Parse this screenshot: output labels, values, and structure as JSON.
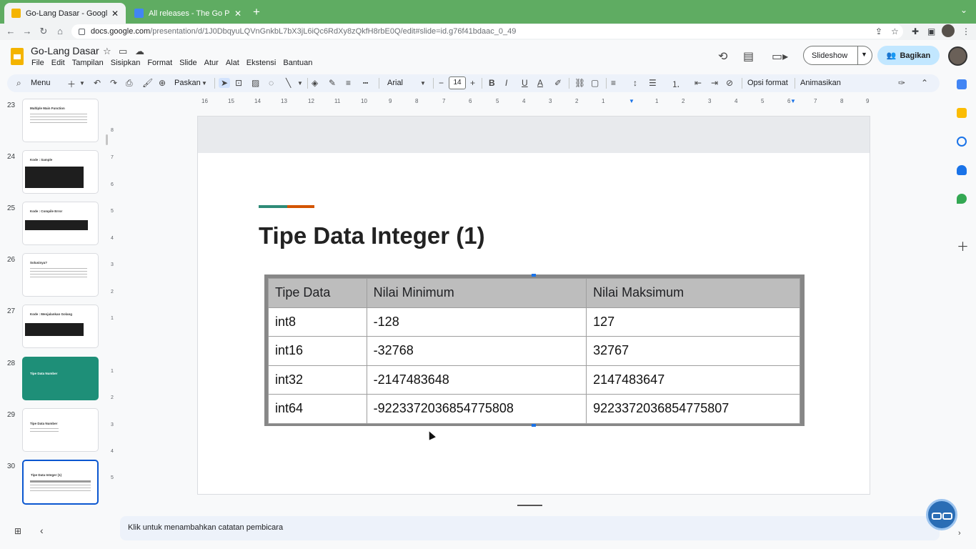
{
  "browser": {
    "tabs": [
      {
        "title": "Go-Lang Dasar - Google Slide",
        "active": true,
        "favicon_color": "#f4b400"
      },
      {
        "title": "All releases - The Go Programm",
        "active": false,
        "favicon_color": "#4285f4"
      }
    ],
    "new_tab_symbol": "+",
    "url_host": "docs.google.com",
    "url_path": "/presentation/d/1J0DbqyuLQVnGnkbL7bX3jL6iQc6RdXy8zQkfH8rbE0Q/edit#slide=id.g76f41bdaac_0_49"
  },
  "app": {
    "doc_title": "Go-Lang Dasar",
    "menu": [
      "File",
      "Edit",
      "Tampilan",
      "Sisipkan",
      "Format",
      "Slide",
      "Atur",
      "Alat",
      "Ekstensi",
      "Bantuan"
    ],
    "slideshow_label": "Slideshow",
    "share_label": "Bagikan"
  },
  "toolbar": {
    "menu_search": "Menu",
    "zoom_label": "Paskan",
    "font_family": "Arial",
    "font_size": "14",
    "format_options": "Opsi format",
    "animate": "Animasikan"
  },
  "filmstrip": [
    {
      "num": "23",
      "title": "Multiple Main Function",
      "kind": "text"
    },
    {
      "num": "24",
      "title": "Kode : Sample",
      "kind": "code"
    },
    {
      "num": "25",
      "title": "Kode : Compile Error",
      "kind": "code"
    },
    {
      "num": "26",
      "title": "Solusinya?",
      "kind": "text"
    },
    {
      "num": "27",
      "title": "Kode : Menjalankan Golang",
      "kind": "code"
    },
    {
      "num": "28",
      "title": "Tipe Data Number",
      "kind": "section"
    },
    {
      "num": "29",
      "title": "Tipe Data Number",
      "kind": "text"
    },
    {
      "num": "30",
      "title": "Tipe Data Integer (1)",
      "kind": "table",
      "selected": true
    }
  ],
  "ruler": {
    "h_ticks": [
      "16",
      "15",
      "14",
      "13",
      "12",
      "11",
      "10",
      "9",
      "8",
      "7",
      "6",
      "5",
      "4",
      "3",
      "2",
      "1",
      "",
      "1",
      "2",
      "3",
      "4",
      "5",
      "6",
      "7",
      "8",
      "9"
    ],
    "v_ticks": [
      "8",
      "7",
      "6",
      "5",
      "4",
      "3",
      "2",
      "1",
      "",
      "1",
      "2",
      "3",
      "4",
      "5"
    ]
  },
  "slide": {
    "title": "Tipe Data Integer (1)",
    "accent_colors": [
      "#2e8b77",
      "#d35400"
    ],
    "table": {
      "headers": [
        "Tipe Data",
        "Nilai Minimum",
        "Nilai Maksimum"
      ],
      "rows": [
        [
          "int8",
          "-128",
          "127"
        ],
        [
          "int16",
          "-32768",
          "32767"
        ],
        [
          "int32",
          "-2147483648",
          "2147483647"
        ],
        [
          "int64",
          "-9223372036854775808",
          "9223372036854775807"
        ]
      ]
    }
  },
  "notes": {
    "placeholder": "Klik untuk menambahkan catatan pembicara"
  }
}
